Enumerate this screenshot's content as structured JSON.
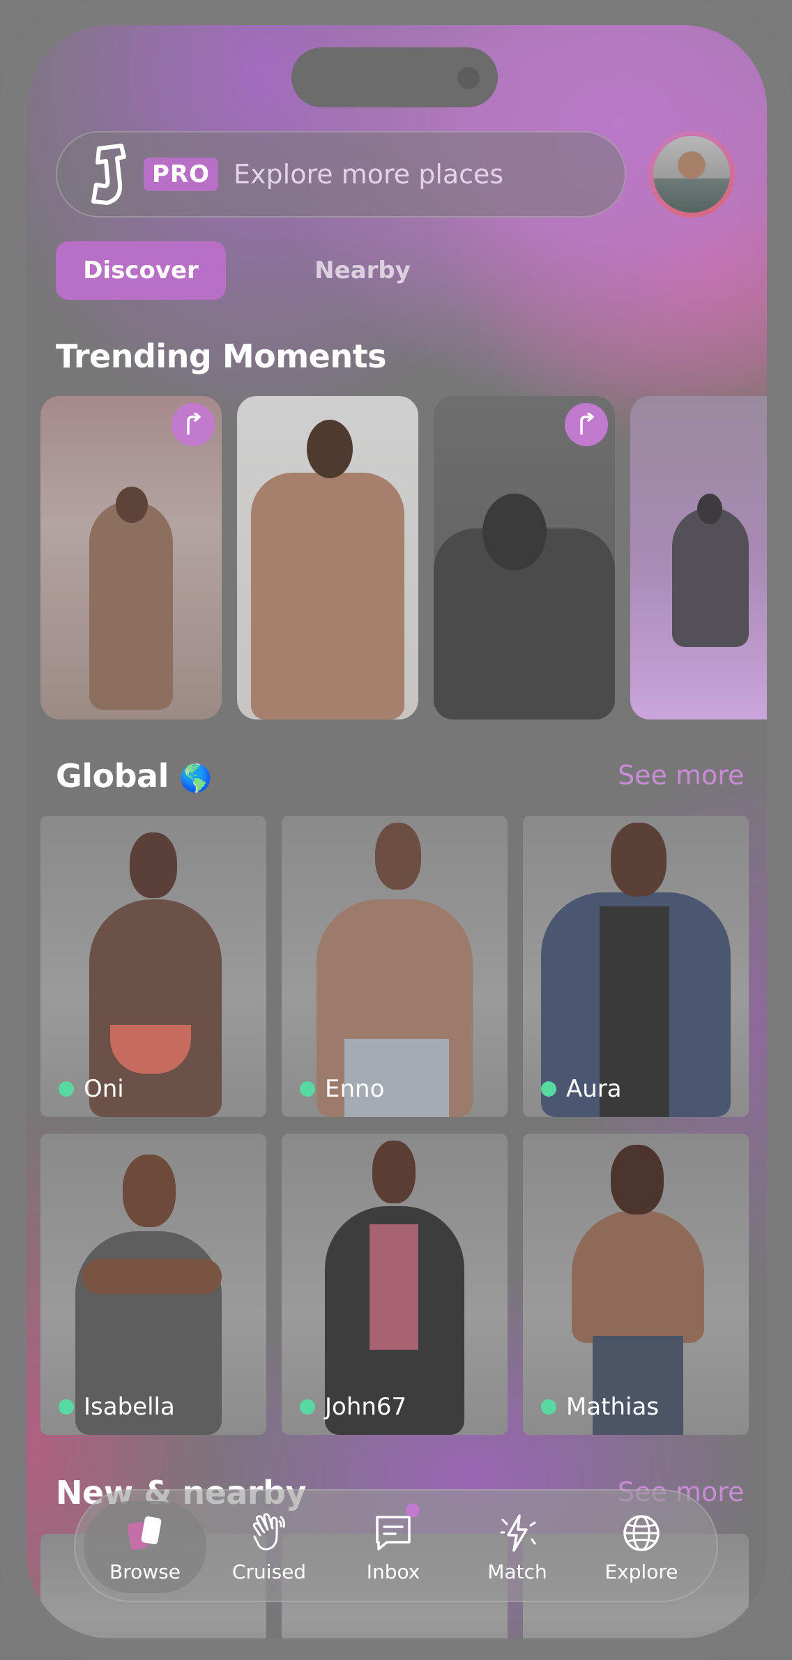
{
  "header": {
    "pro_label": "PRO",
    "search_placeholder": "Explore more places"
  },
  "tabs": [
    {
      "label": "Discover",
      "active": true
    },
    {
      "label": "Nearby",
      "active": false
    }
  ],
  "trending": {
    "title": "Trending Moments",
    "items": [
      {
        "reposted": true
      },
      {
        "reposted": false
      },
      {
        "reposted": true
      },
      {
        "reposted": false
      }
    ]
  },
  "global": {
    "title": "Global",
    "emoji": "🌎",
    "see_more": "See more",
    "profiles": [
      {
        "name": "Oni",
        "online": true
      },
      {
        "name": "Enno",
        "online": true
      },
      {
        "name": "Aura",
        "online": true
      },
      {
        "name": "Isabella",
        "online": true
      },
      {
        "name": "John67",
        "online": true
      },
      {
        "name": "Mathias",
        "online": true
      }
    ]
  },
  "nearby": {
    "title": "New & nearby",
    "see_more": "See more"
  },
  "nav": [
    {
      "label": "Browse",
      "icon": "browse-cards-icon",
      "active": true
    },
    {
      "label": "Cruised",
      "icon": "waving-hand-icon",
      "active": false
    },
    {
      "label": "Inbox",
      "icon": "message-icon",
      "active": false,
      "badge": true
    },
    {
      "label": "Match",
      "icon": "lightning-icon",
      "active": false
    },
    {
      "label": "Explore",
      "icon": "globe-icon",
      "active": false
    }
  ],
  "colors": {
    "accent": "#b86fc6",
    "online": "#58d9a1"
  }
}
